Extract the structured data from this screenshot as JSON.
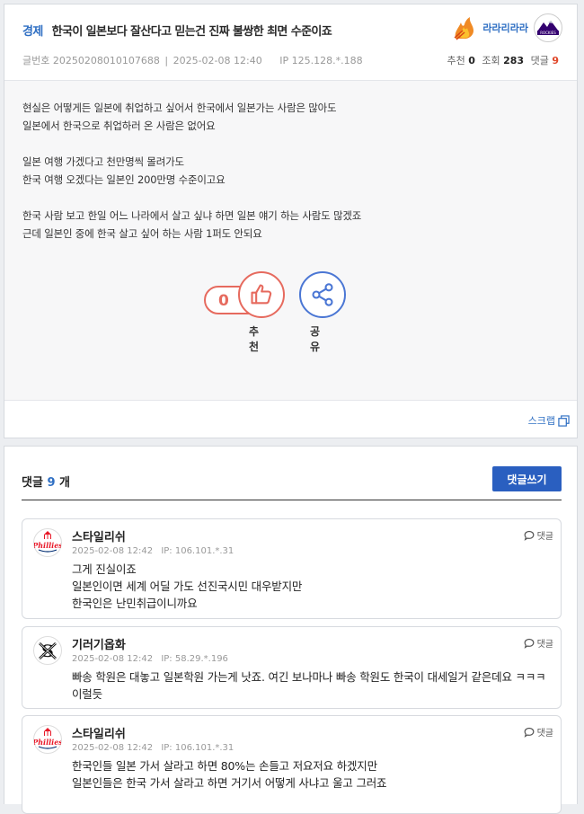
{
  "post": {
    "category": "경제",
    "title": "한국이 일본보다 잘산다고 믿는건 진짜 불쌍한 최면 수준이죠",
    "author": "라라리라라",
    "author_icon": "flame-icon",
    "team_logo": "rockies-logo",
    "post_no_label": "글번호",
    "post_no": "20250208010107688",
    "date": "2025-02-08 12:40",
    "ip_label": "IP",
    "ip": "125.128.*.188",
    "recommend_label": "추천",
    "recommend_count": "0",
    "views_label": "조회",
    "views_count": "283",
    "comments_label": "댓글",
    "comments_count": "9",
    "body_lines": [
      "현실은 어떻게든 일본에 취업하고 싶어서 한국에서 일본가는 사람은 많아도",
      "일본에서 한국으로 취업하러 온 사람은 없어요",
      "",
      "일본 여행 가겠다고 천만명씩 몰려가도",
      "한국 여행 오겠다는 일본인 200만명 수준이고요",
      "",
      "한국 사람 보고 한일 어느 나라에서 살고 싶냐 하면 일본 얘기 하는 사람도 많겠죠",
      "근데 일본인 중에 한국 살고 싶어 하는 사람 1퍼도 안되요"
    ],
    "vote_count": "0",
    "vote_label": "추천",
    "share_label": "공유",
    "scrap_label": "스크랩"
  },
  "comments_section": {
    "title": "댓글",
    "count": "9",
    "unit": "개",
    "write_label": "댓글쓰기",
    "reply_label": "댓글",
    "items": [
      {
        "nick": "스타일리쉬",
        "date": "2025-02-08 12:42",
        "ip": "IP: 106.101.*.31",
        "logo": "phillies-logo",
        "lines": [
          "그게 진실이죠",
          "일본인이면 세계 어딜 가도 선진국시민 대우받지만",
          "한국인은 난민취급이니까요"
        ]
      },
      {
        "nick": "기러기옵화",
        "date": "2025-02-08 12:42",
        "ip": "IP: 58.29.*.196",
        "logo": "white-sox-logo",
        "lines": [
          "빠송 학원은 대놓고 일본학원 가는게 낫죠. 여긴 보나마나 빠송 학원도 한국이 대세일거 같은데요 ㅋㅋㅋ 이럴듯"
        ]
      },
      {
        "nick": "스타일리쉬",
        "date": "2025-02-08 12:42",
        "ip": "IP: 106.101.*.31",
        "logo": "phillies-logo",
        "lines": [
          "한국인들 일본 가서 살라고 하면 80%는 손들고 저요저요 하겠지만",
          "일본인들은 한국 가서 살라고 하면 거기서 어떻게 사냐고 울고 그러죠"
        ]
      }
    ]
  }
}
